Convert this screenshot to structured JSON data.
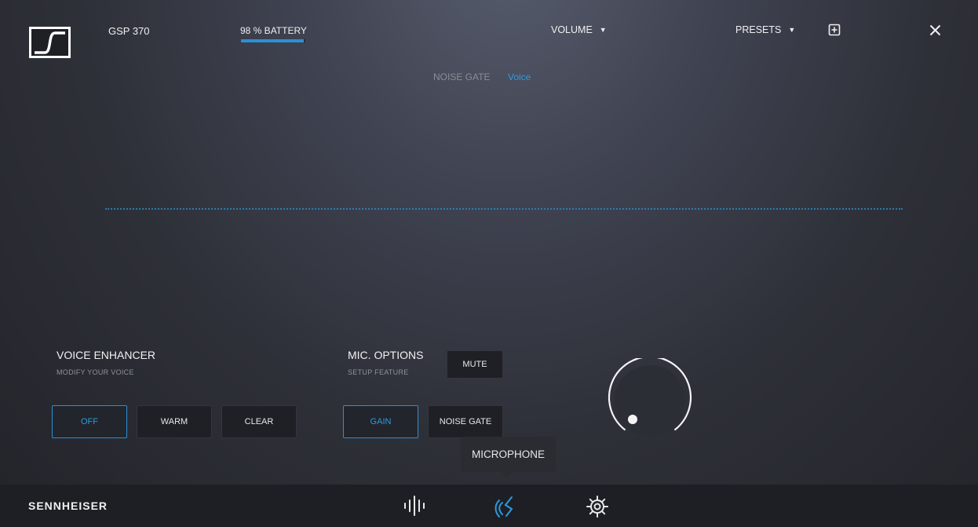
{
  "header": {
    "model": "GSP 370",
    "battery_label": "98 % BATTERY",
    "battery_level": 0.98,
    "volume_label": "VOLUME",
    "presets_label": "PRESETS",
    "caret": "▼"
  },
  "tabs": {
    "noise_gate": "NOISE GATE",
    "voice": "Voice"
  },
  "voice_enhancer": {
    "title": "VOICE ENHANCER",
    "subtitle": "MODIFY YOUR VOICE",
    "options": [
      "OFF",
      "WARM",
      "CLEAR"
    ],
    "selected": "OFF"
  },
  "mic_options": {
    "title": "MIC. OPTIONS",
    "subtitle": "SETUP FEATURE",
    "mute": "MUTE",
    "options": [
      "GAIN",
      "NOISE GATE"
    ],
    "selected": "GAIN"
  },
  "tooltip": "MICROPHONE",
  "footer": {
    "brand": "SENNHEISER"
  },
  "icons": {
    "logo": "sennheiser-logo",
    "add": "add-preset-icon",
    "close": "close-icon",
    "equalizer": "equalizer-icon",
    "microphone": "microphone-icon",
    "settings": "gear-icon"
  },
  "colors": {
    "accent": "#2b8fd6",
    "footer": "#1e1f24",
    "button_bg": "#1f2025"
  }
}
